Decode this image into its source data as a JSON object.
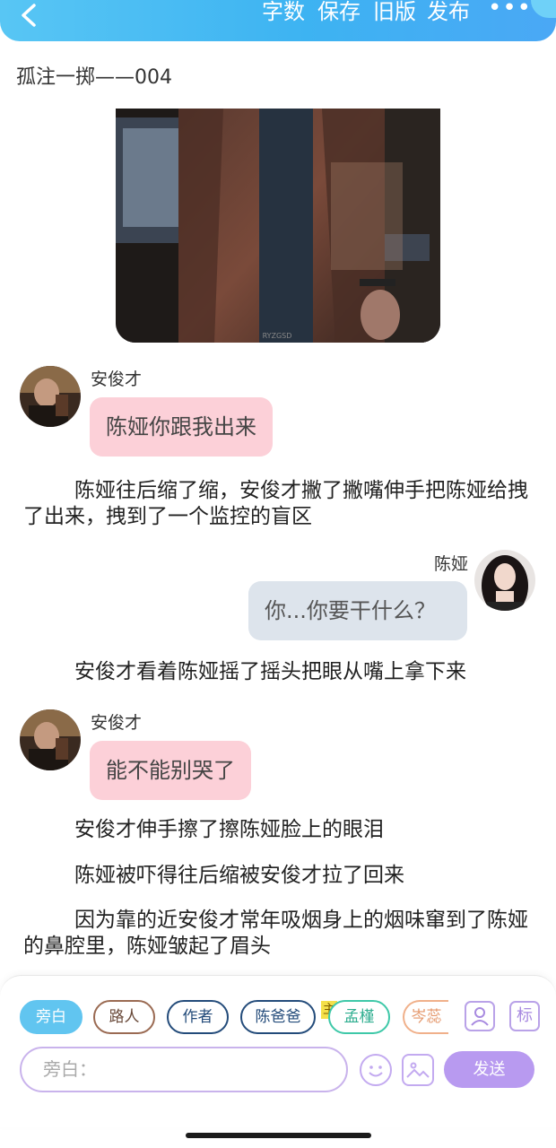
{
  "topbar": {
    "back_icon": "chevron-left-icon",
    "actions": [
      "字数",
      "保存",
      "旧版",
      "发布"
    ],
    "more_label": "•••",
    "accent": "#3db3f2"
  },
  "story": {
    "title": "孤注一掷——004",
    "cover_watermark": "RYZGSD"
  },
  "messages": [
    {
      "speaker": "安俊才",
      "text": "陈娅你跟我出来"
    },
    {
      "narration": "陈娅往后缩了缩，安俊才撇了撇嘴伸手把陈娅给拽了出来，拽到了一个监控的盲区"
    },
    {
      "speaker": "陈娅",
      "text": "你...你要干什么？"
    },
    {
      "narration": "安俊才看着陈娅摇了摇头把眼从嘴上拿下来"
    },
    {
      "speaker": "安俊才",
      "text": "能不能别哭了"
    },
    {
      "narration": "安俊才伸手擦了擦陈娅脸上的眼泪"
    },
    {
      "narration": "陈娅被吓得往后缩被安俊才拉了回来"
    },
    {
      "narration": "因为靠的近安俊才常年吸烟身上的烟味窜到了陈娅的鼻腔里，陈娅皱起了眉头"
    }
  ],
  "composer": {
    "roles": [
      "旁白",
      "路人",
      "作者",
      "陈爸爸",
      "孟槿",
      "岑蕊"
    ],
    "main_badge": "主",
    "profile_icon": "person-icon",
    "tag_label": "标",
    "input_placeholder": "旁白：",
    "emoji_icon": "smiley-icon",
    "image_icon": "image-icon",
    "send_label": "发送"
  },
  "colors": {
    "pink_bubble": "#fcd0d8",
    "gray_bubble": "#dde4ec",
    "active_chip": "#61c5f0",
    "send": "#b89af0"
  }
}
